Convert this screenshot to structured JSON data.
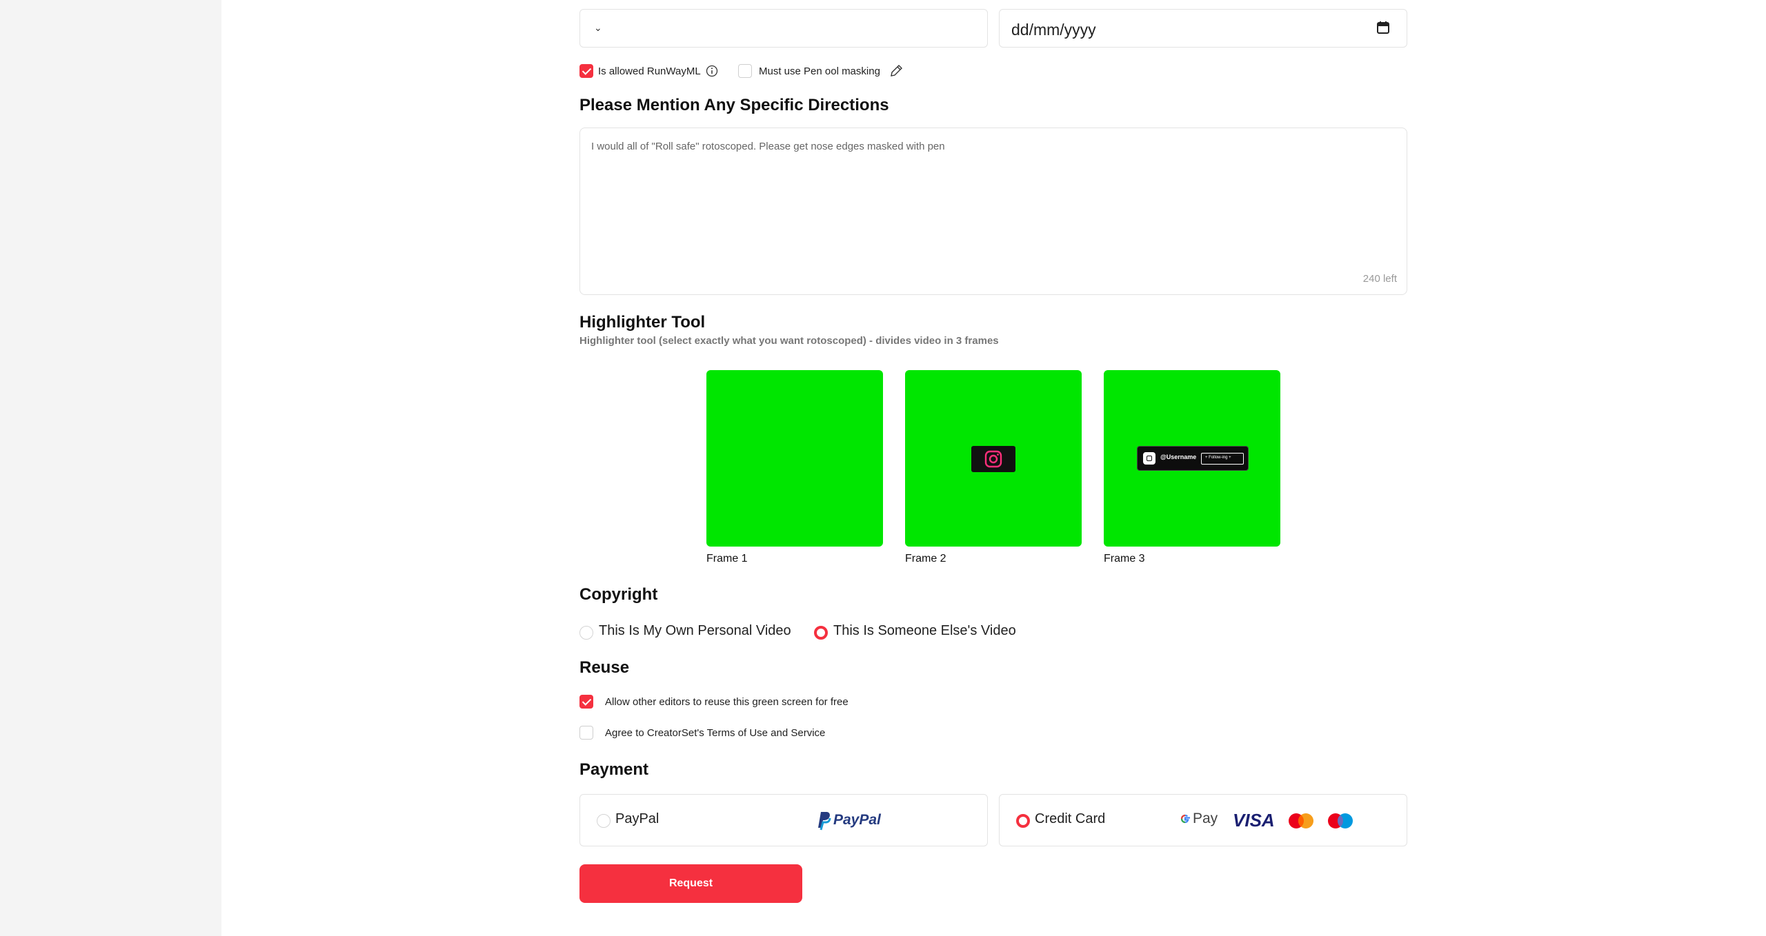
{
  "top_select": {
    "value": ""
  },
  "date_input": {
    "placeholder": "dd/mm/yyyy"
  },
  "options": {
    "runway_label": "Is allowed RunWayML",
    "runway_checked": true,
    "pen_label": "Must use Pen ool masking",
    "pen_checked": false
  },
  "directions": {
    "title": "Please Mention Any Specific Directions",
    "text": "I would all of \"Roll safe\" rotoscoped. Please get nose edges masked with pen",
    "counter": "240 left"
  },
  "highlighter": {
    "title": "Highlighter Tool",
    "subtitle": "Highlighter tool (select exactly what you want rotoscoped) - divides video in 3 frames",
    "frames": [
      {
        "label": "Frame 1"
      },
      {
        "label": "Frame 2"
      },
      {
        "label": "Frame 3",
        "badge_user": "@Username",
        "badge_follow": "+ Follow-ing +"
      }
    ]
  },
  "copyright": {
    "title": "Copyright",
    "options": [
      {
        "label": "This Is My Own Personal Video",
        "selected": false
      },
      {
        "label": "This Is Someone Else's Video",
        "selected": true
      }
    ]
  },
  "reuse": {
    "title": "Reuse",
    "items": [
      {
        "label": "Allow other editors to reuse this green screen for free",
        "checked": true
      },
      {
        "label": "Agree to CreatorSet's Terms of Use and Service",
        "checked": false
      }
    ]
  },
  "payment": {
    "title": "Payment",
    "paypal_label": "PayPal",
    "paypal_logo_text": "PayPal",
    "credit_label": "Credit Card",
    "gpay_text": "Pay",
    "visa_text": "VISA",
    "selected": "credit"
  },
  "request_button": "Request",
  "colors": {
    "accent": "#f5303f",
    "green_screen": "#00e600",
    "sidebar": "#f4f4f4"
  }
}
